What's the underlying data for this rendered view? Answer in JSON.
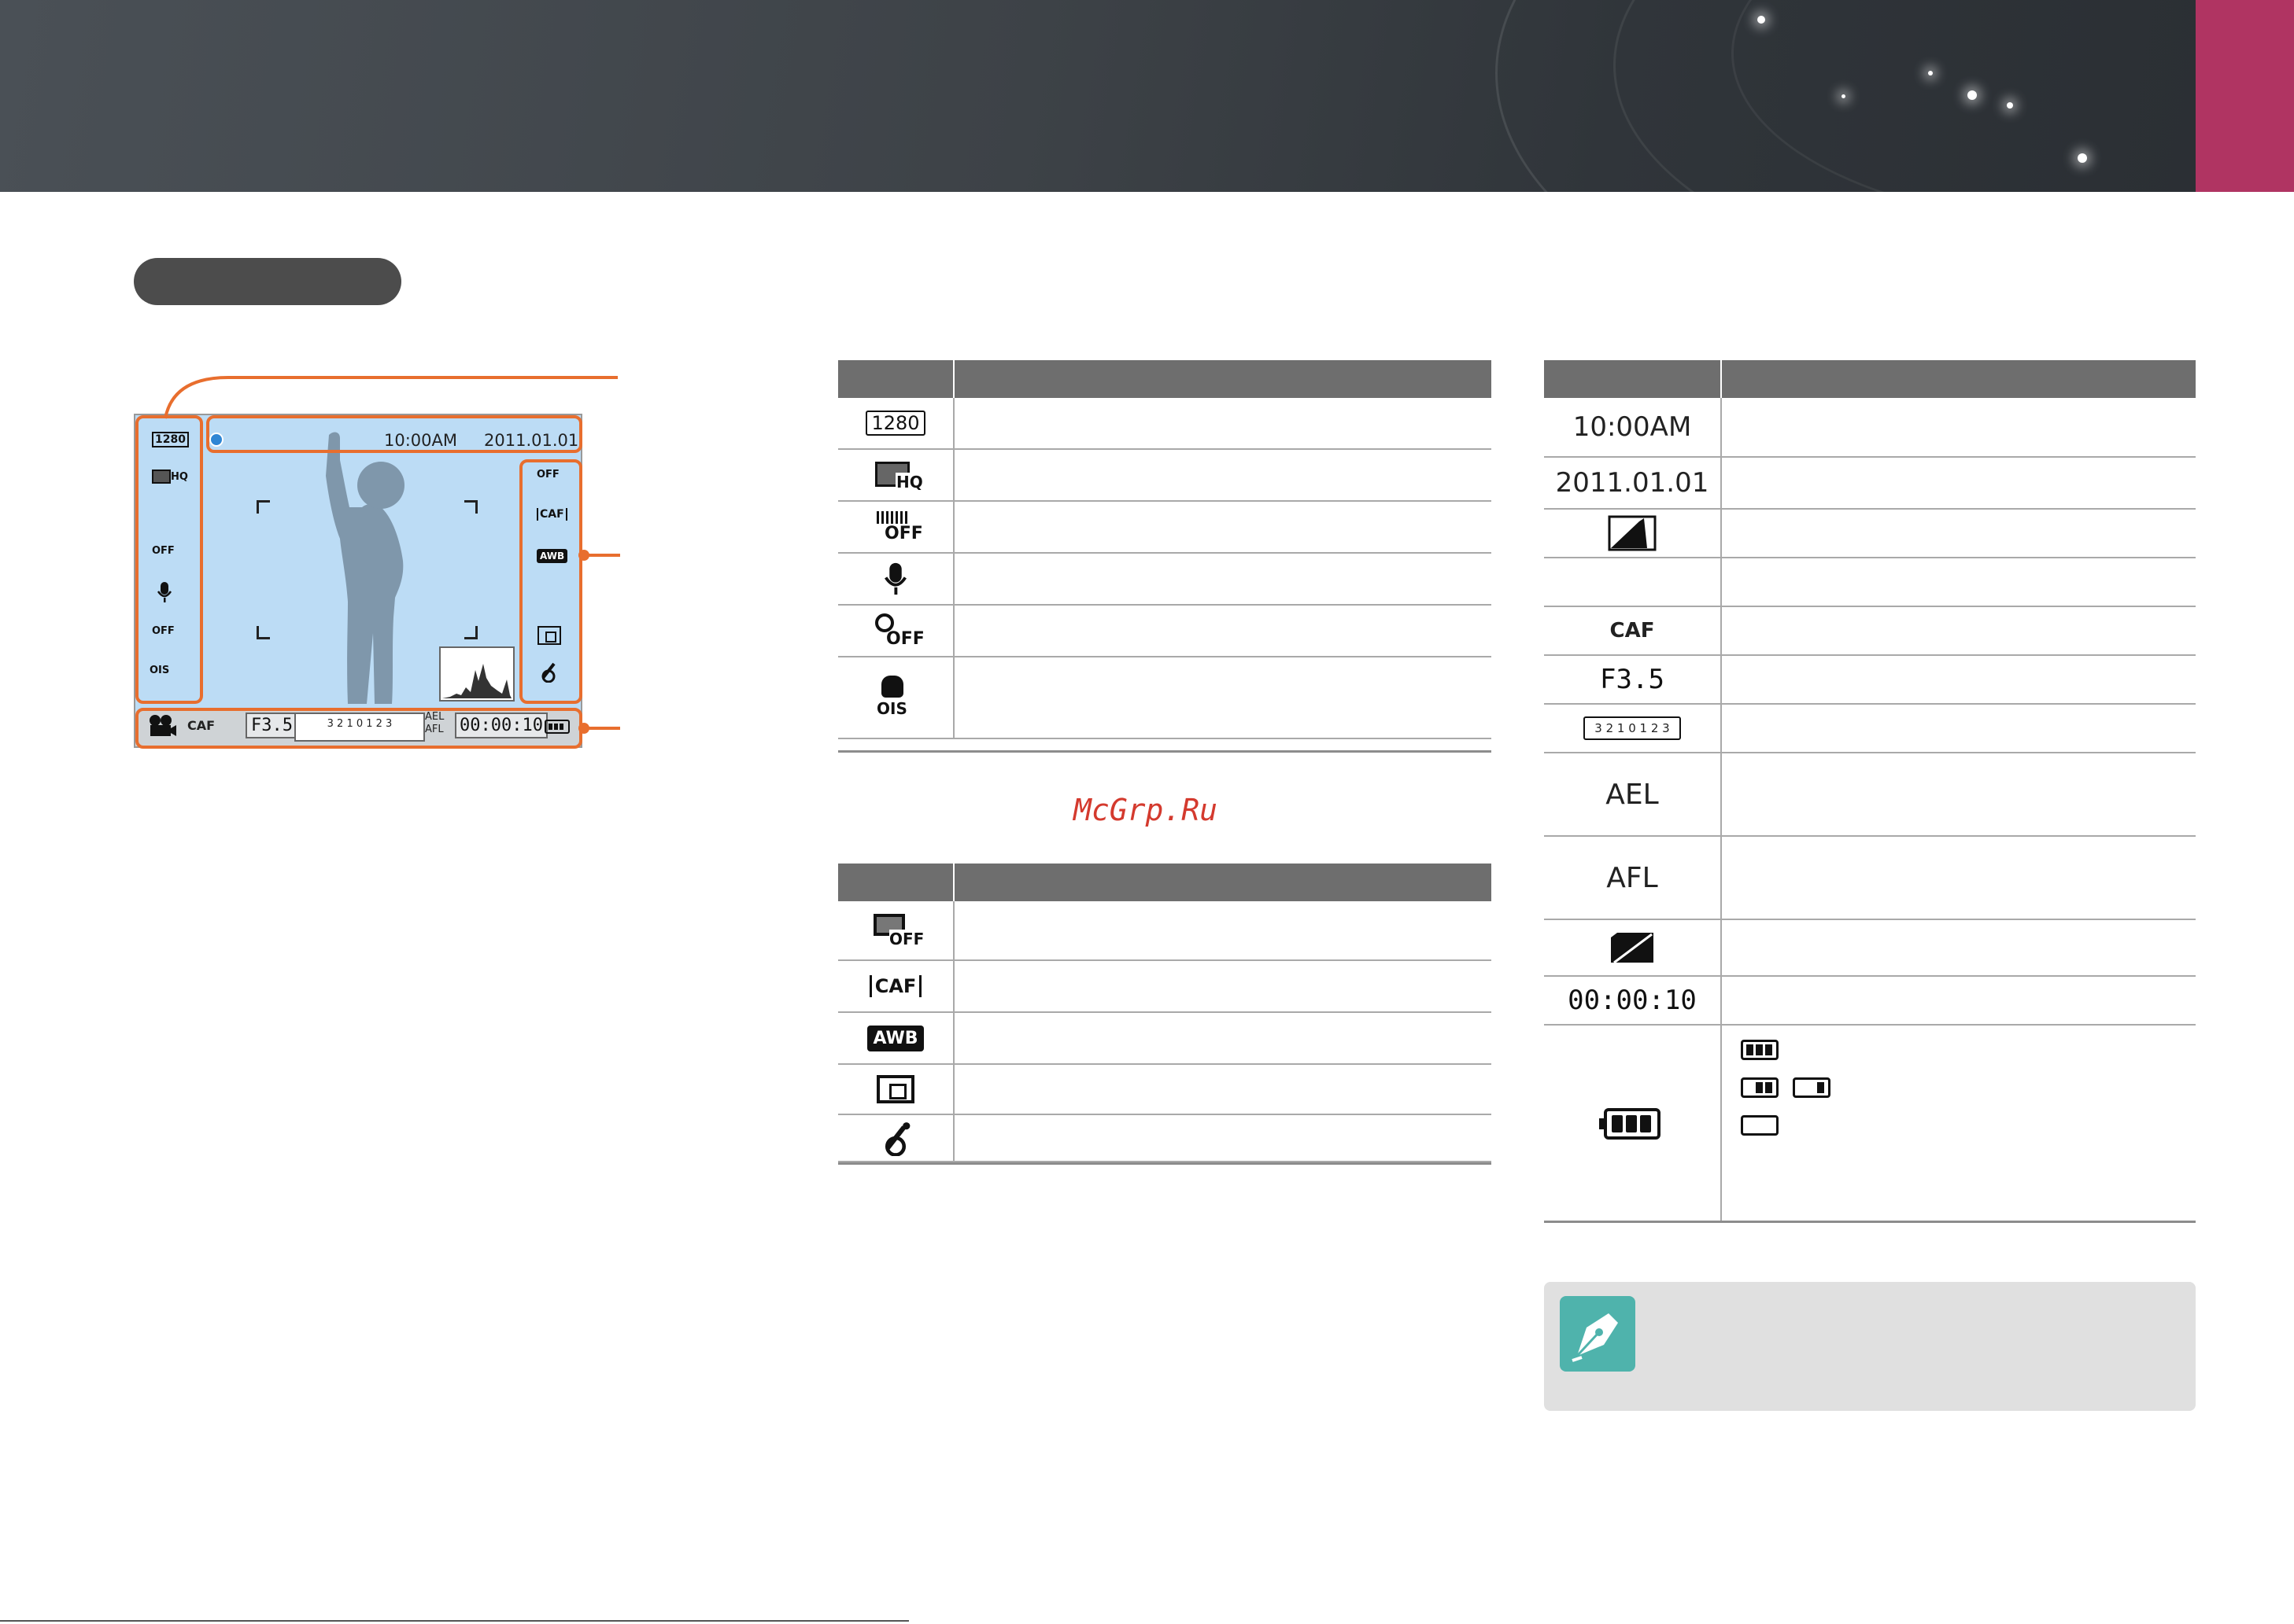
{
  "colors": {
    "accent_tab": "#b03462",
    "callout": "#e86e2e",
    "table_header": "#6e6e6e",
    "watermark": "#d43a2e",
    "note_icon": "#4fb3ac",
    "screen_bg": "#bcdcf5"
  },
  "screen": {
    "time": "10:00AM",
    "date": "2011.01.01",
    "left_icons": [
      "1280",
      "HQ",
      "OFF",
      "mic-icon",
      "OFF",
      "OIS"
    ],
    "right_icons": [
      "OFF",
      "CAF",
      "AWB",
      "metering-icon",
      "face-retouch-icon"
    ],
    "status_bar": {
      "mode": "movie-icon",
      "focus": "CAF",
      "aperture": "F3.5",
      "scale": "3 2 1 0 1 2 3",
      "ael": "AEL",
      "afl": "AFL",
      "timer": "00:00:10"
    }
  },
  "table1": {
    "icons": [
      "1280",
      "HQ",
      "OFF",
      "mic-icon",
      "OFF",
      "OIS"
    ]
  },
  "table2": {
    "icons": [
      "OFF",
      "CAF",
      "AWB",
      "metering-icon",
      "face-retouch-icon"
    ]
  },
  "table3": {
    "rows": [
      {
        "icon": "10:00AM"
      },
      {
        "icon": "2011.01.01"
      },
      {
        "icon": "histogram-icon"
      },
      {
        "icon": ""
      },
      {
        "icon": "CAF"
      },
      {
        "icon": "F3.5"
      },
      {
        "icon": "3 2 1 0 1 2 3"
      },
      {
        "icon": "AEL"
      },
      {
        "icon": "AFL"
      },
      {
        "icon": "no-card-icon"
      },
      {
        "icon": "00:00:10"
      },
      {
        "icon": "battery-icon"
      }
    ]
  },
  "watermark": "McGrp.Ru"
}
